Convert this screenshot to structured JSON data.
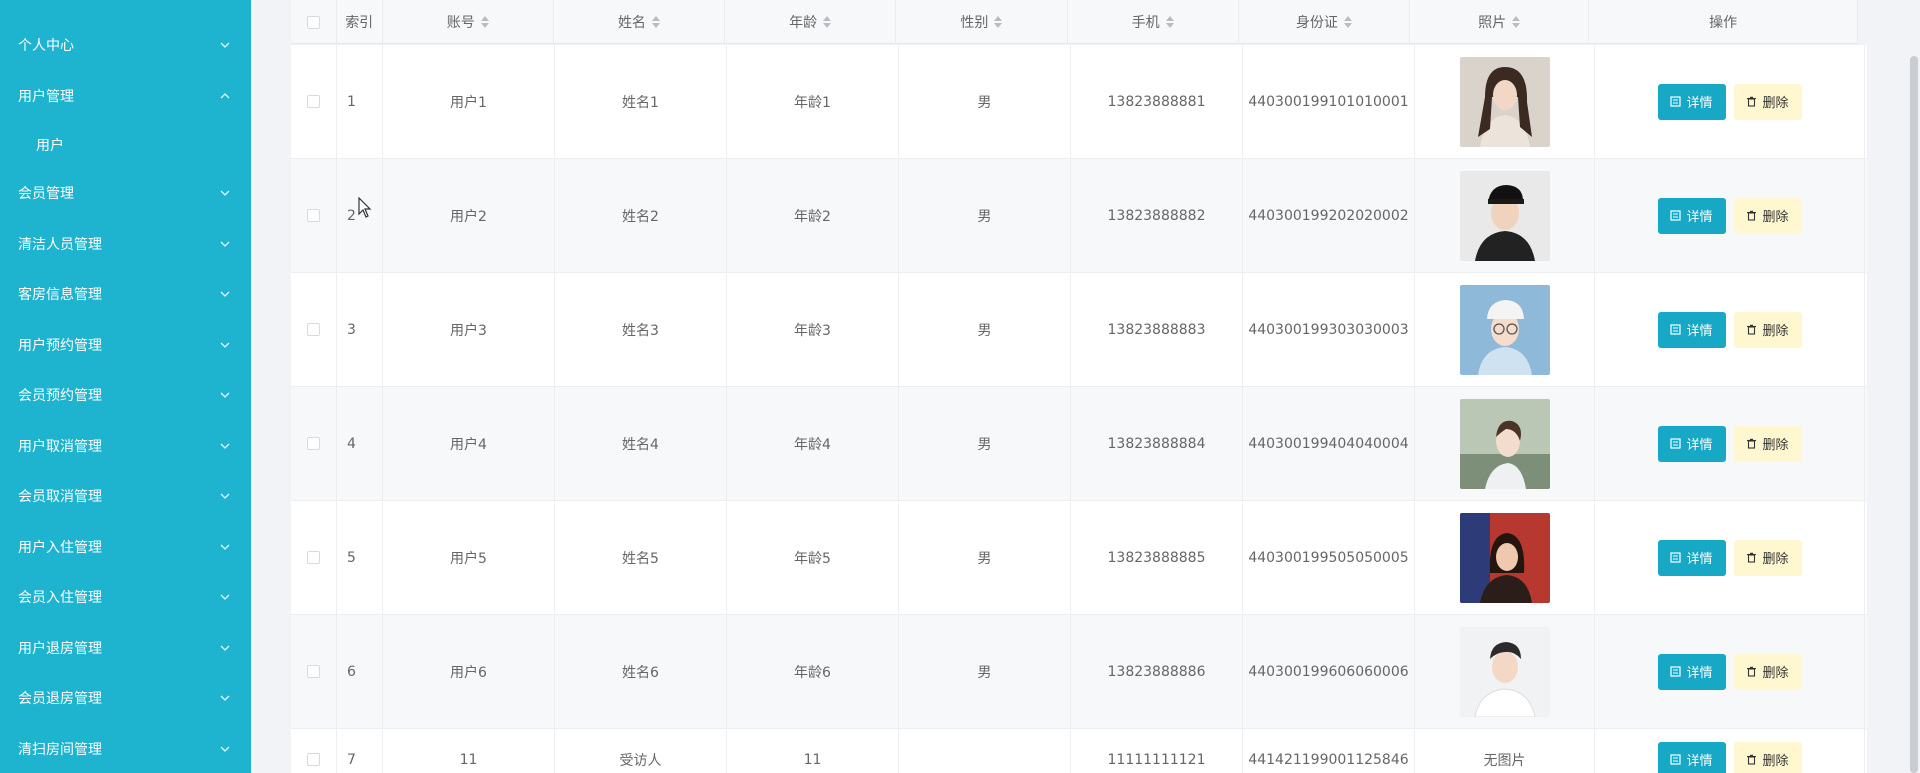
{
  "sidebar": {
    "items": [
      {
        "label": "个人中心",
        "expanded": false
      },
      {
        "label": "用户管理",
        "expanded": true,
        "children": [
          "用户"
        ]
      },
      {
        "label": "会员管理",
        "expanded": false
      },
      {
        "label": "清洁人员管理",
        "expanded": false
      },
      {
        "label": "客房信息管理",
        "expanded": false
      },
      {
        "label": "用户预约管理",
        "expanded": false
      },
      {
        "label": "会员预约管理",
        "expanded": false
      },
      {
        "label": "用户取消管理",
        "expanded": false
      },
      {
        "label": "会员取消管理",
        "expanded": false
      },
      {
        "label": "用户入住管理",
        "expanded": false
      },
      {
        "label": "会员入住管理",
        "expanded": false
      },
      {
        "label": "用户退房管理",
        "expanded": false
      },
      {
        "label": "会员退房管理",
        "expanded": false
      },
      {
        "label": "清扫房间管理",
        "expanded": false
      }
    ]
  },
  "table": {
    "headers": {
      "index": "索引",
      "account": "账号",
      "name": "姓名",
      "age": "年龄",
      "gender": "性别",
      "phone": "手机",
      "idcard": "身份证",
      "photo": "照片",
      "ops": "操作"
    },
    "buttons": {
      "detail": "详情",
      "delete": "删除"
    },
    "no_photo": "无图片",
    "rows": [
      {
        "index": "1",
        "account": "用户1",
        "name": "姓名1",
        "age": "年龄1",
        "gender": "男",
        "phone": "13823888881",
        "idcard": "440300199101010001",
        "photo": "woman-long-hair"
      },
      {
        "index": "2",
        "account": "用户2",
        "name": "姓名2",
        "age": "年龄2",
        "gender": "男",
        "phone": "13823888882",
        "idcard": "440300199202020002",
        "photo": "man-black-cap"
      },
      {
        "index": "3",
        "account": "用户3",
        "name": "姓名3",
        "age": "年龄3",
        "gender": "男",
        "phone": "13823888883",
        "idcard": "440300199303030003",
        "photo": "woman-white-cap"
      },
      {
        "index": "4",
        "account": "用户4",
        "name": "姓名4",
        "age": "年龄4",
        "gender": "男",
        "phone": "13823888884",
        "idcard": "440300199404040004",
        "photo": "woman-profile"
      },
      {
        "index": "5",
        "account": "用户5",
        "name": "姓名5",
        "age": "年龄5",
        "gender": "男",
        "phone": "13823888885",
        "idcard": "440300199505050005",
        "photo": "woman-red-bg"
      },
      {
        "index": "6",
        "account": "用户6",
        "name": "姓名6",
        "age": "年龄6",
        "gender": "男",
        "phone": "13823888886",
        "idcard": "440300199606060006",
        "photo": "man-white-shirt"
      },
      {
        "index": "7",
        "account": "11",
        "name": "受访人",
        "age": "11",
        "gender": "",
        "phone": "11111111121",
        "idcard": "441421199001125846",
        "photo": ""
      }
    ]
  },
  "colors": {
    "sidebar_bg": "#1eb3cf",
    "detail_btn": "#17a8c6",
    "delete_btn": "#fff7cf"
  }
}
